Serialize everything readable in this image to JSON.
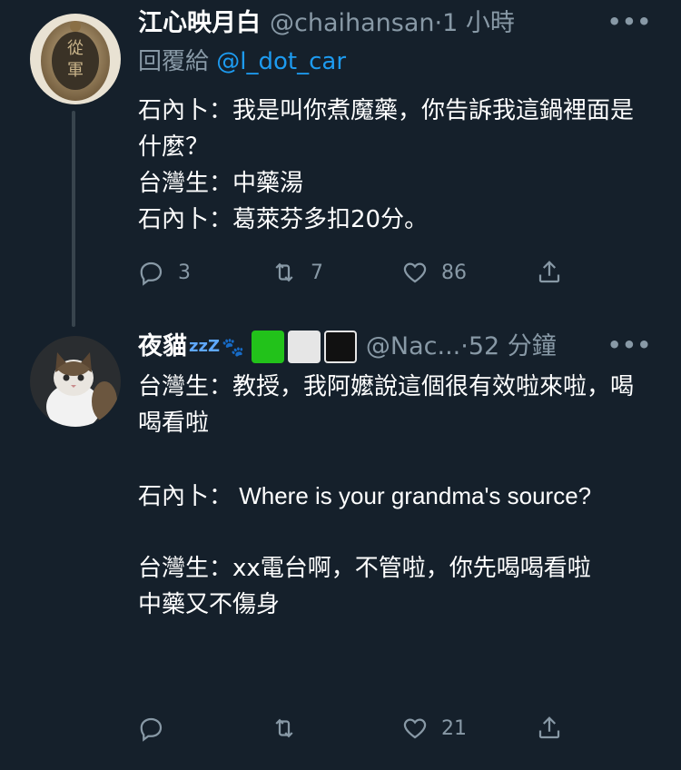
{
  "tweet1": {
    "display_name": "江心映月白",
    "handle": "@chaihansan",
    "separator": "·",
    "time": "1 小時",
    "more": "•••",
    "replying_prefix": "回覆給",
    "replying_to": "@l_dot_car",
    "lines": [
      "石內卜：我是叫你煮魔藥，你告訴我這鍋裡面是什麼？",
      "台灣生：中藥湯",
      "石內卜：葛萊芬多扣20分。"
    ],
    "reply_count": "3",
    "retweet_count": "7",
    "like_count": "86",
    "avatar_icon": "seal-badge-icon"
  },
  "tweet2": {
    "display_name": "夜貓",
    "zzz": "zzZ",
    "paws": "🐾",
    "handle": "@Nac...",
    "separator": "·",
    "time": "52 分鐘",
    "more": "•••",
    "lines": [
      "台灣生：教授，我阿嬤說這個很有效啦來啦，喝喝看啦",
      "",
      "石內卜： Where is your grandma's source?",
      "",
      "台灣生：xx電台啊，不管啦，你先喝喝看啦",
      "中藥又不傷身"
    ],
    "reply_count": "",
    "retweet_count": "",
    "like_count": "21",
    "avatar_icon": "cat-avatar-icon",
    "emoji_colors": [
      "#22c21a",
      "#e6e6e6",
      "#111111"
    ]
  },
  "colors": {
    "background": "#15202b",
    "secondary_text": "#8899a6",
    "link": "#1d9bf0",
    "thread_line": "#38444d"
  }
}
